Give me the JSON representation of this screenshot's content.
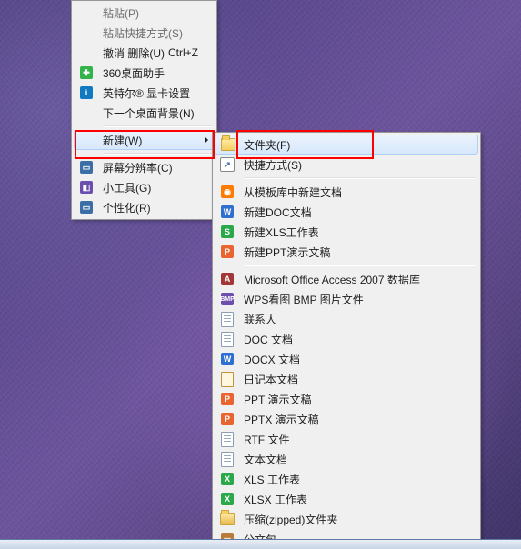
{
  "mainMenu": {
    "paste": "粘贴(P)",
    "pasteShortcut": "粘贴快捷方式(S)",
    "undoDelete": "撤消 删除(U)",
    "undoDeleteKey": "Ctrl+Z",
    "desk360": "360桌面助手",
    "intel": "英特尔® 显卡设置",
    "nextBg": "下一个桌面背景(N)",
    "new": "新建(W)",
    "resolution": "屏幕分辨率(C)",
    "gadgets": "小工具(G)",
    "personalize": "个性化(R)"
  },
  "subMenu": {
    "folder": "文件夹(F)",
    "shortcut": "快捷方式(S)",
    "template": "从模板库中新建文档",
    "docNew": "新建DOC文档",
    "xlsNew": "新建XLS工作表",
    "pptNew": "新建PPT演示文稿",
    "access": "Microsoft Office Access 2007 数据库",
    "wpsBmp": "WPS看图 BMP 图片文件",
    "contact": "联系人",
    "doc": "DOC 文档",
    "docx": "DOCX 文档",
    "journal": "日记本文档",
    "ppt": "PPT 演示文稿",
    "pptx": "PPTX 演示文稿",
    "rtf": "RTF 文件",
    "txt": "文本文档",
    "xls": "XLS 工作表",
    "xlsx": "XLSX 工作表",
    "zip": "压缩(zipped)文件夹",
    "briefcase": "公文包"
  }
}
